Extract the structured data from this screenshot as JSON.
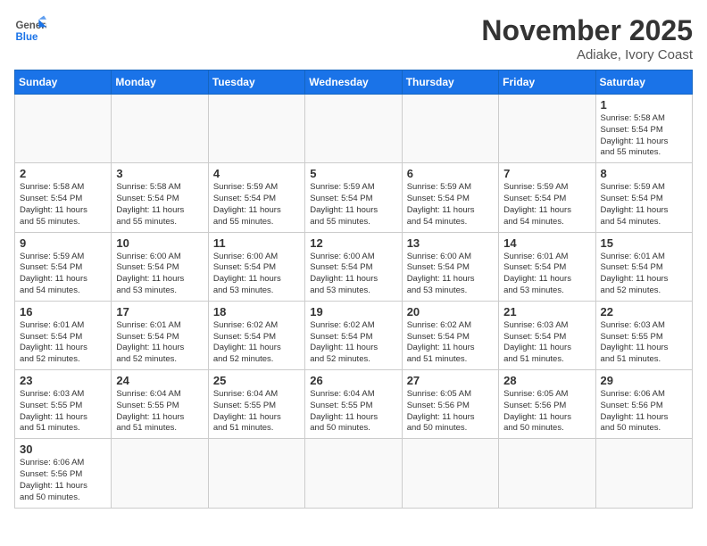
{
  "header": {
    "logo_general": "General",
    "logo_blue": "Blue",
    "month_title": "November 2025",
    "location": "Adiake, Ivory Coast"
  },
  "weekdays": [
    "Sunday",
    "Monday",
    "Tuesday",
    "Wednesday",
    "Thursday",
    "Friday",
    "Saturday"
  ],
  "weeks": [
    [
      {
        "day": "",
        "info": ""
      },
      {
        "day": "",
        "info": ""
      },
      {
        "day": "",
        "info": ""
      },
      {
        "day": "",
        "info": ""
      },
      {
        "day": "",
        "info": ""
      },
      {
        "day": "",
        "info": ""
      },
      {
        "day": "1",
        "info": "Sunrise: 5:58 AM\nSunset: 5:54 PM\nDaylight: 11 hours\nand 55 minutes."
      }
    ],
    [
      {
        "day": "2",
        "info": "Sunrise: 5:58 AM\nSunset: 5:54 PM\nDaylight: 11 hours\nand 55 minutes."
      },
      {
        "day": "3",
        "info": "Sunrise: 5:58 AM\nSunset: 5:54 PM\nDaylight: 11 hours\nand 55 minutes."
      },
      {
        "day": "4",
        "info": "Sunrise: 5:59 AM\nSunset: 5:54 PM\nDaylight: 11 hours\nand 55 minutes."
      },
      {
        "day": "5",
        "info": "Sunrise: 5:59 AM\nSunset: 5:54 PM\nDaylight: 11 hours\nand 55 minutes."
      },
      {
        "day": "6",
        "info": "Sunrise: 5:59 AM\nSunset: 5:54 PM\nDaylight: 11 hours\nand 54 minutes."
      },
      {
        "day": "7",
        "info": "Sunrise: 5:59 AM\nSunset: 5:54 PM\nDaylight: 11 hours\nand 54 minutes."
      },
      {
        "day": "8",
        "info": "Sunrise: 5:59 AM\nSunset: 5:54 PM\nDaylight: 11 hours\nand 54 minutes."
      }
    ],
    [
      {
        "day": "9",
        "info": "Sunrise: 5:59 AM\nSunset: 5:54 PM\nDaylight: 11 hours\nand 54 minutes."
      },
      {
        "day": "10",
        "info": "Sunrise: 6:00 AM\nSunset: 5:54 PM\nDaylight: 11 hours\nand 53 minutes."
      },
      {
        "day": "11",
        "info": "Sunrise: 6:00 AM\nSunset: 5:54 PM\nDaylight: 11 hours\nand 53 minutes."
      },
      {
        "day": "12",
        "info": "Sunrise: 6:00 AM\nSunset: 5:54 PM\nDaylight: 11 hours\nand 53 minutes."
      },
      {
        "day": "13",
        "info": "Sunrise: 6:00 AM\nSunset: 5:54 PM\nDaylight: 11 hours\nand 53 minutes."
      },
      {
        "day": "14",
        "info": "Sunrise: 6:01 AM\nSunset: 5:54 PM\nDaylight: 11 hours\nand 53 minutes."
      },
      {
        "day": "15",
        "info": "Sunrise: 6:01 AM\nSunset: 5:54 PM\nDaylight: 11 hours\nand 52 minutes."
      }
    ],
    [
      {
        "day": "16",
        "info": "Sunrise: 6:01 AM\nSunset: 5:54 PM\nDaylight: 11 hours\nand 52 minutes."
      },
      {
        "day": "17",
        "info": "Sunrise: 6:01 AM\nSunset: 5:54 PM\nDaylight: 11 hours\nand 52 minutes."
      },
      {
        "day": "18",
        "info": "Sunrise: 6:02 AM\nSunset: 5:54 PM\nDaylight: 11 hours\nand 52 minutes."
      },
      {
        "day": "19",
        "info": "Sunrise: 6:02 AM\nSunset: 5:54 PM\nDaylight: 11 hours\nand 52 minutes."
      },
      {
        "day": "20",
        "info": "Sunrise: 6:02 AM\nSunset: 5:54 PM\nDaylight: 11 hours\nand 51 minutes."
      },
      {
        "day": "21",
        "info": "Sunrise: 6:03 AM\nSunset: 5:54 PM\nDaylight: 11 hours\nand 51 minutes."
      },
      {
        "day": "22",
        "info": "Sunrise: 6:03 AM\nSunset: 5:55 PM\nDaylight: 11 hours\nand 51 minutes."
      }
    ],
    [
      {
        "day": "23",
        "info": "Sunrise: 6:03 AM\nSunset: 5:55 PM\nDaylight: 11 hours\nand 51 minutes."
      },
      {
        "day": "24",
        "info": "Sunrise: 6:04 AM\nSunset: 5:55 PM\nDaylight: 11 hours\nand 51 minutes."
      },
      {
        "day": "25",
        "info": "Sunrise: 6:04 AM\nSunset: 5:55 PM\nDaylight: 11 hours\nand 51 minutes."
      },
      {
        "day": "26",
        "info": "Sunrise: 6:04 AM\nSunset: 5:55 PM\nDaylight: 11 hours\nand 50 minutes."
      },
      {
        "day": "27",
        "info": "Sunrise: 6:05 AM\nSunset: 5:56 PM\nDaylight: 11 hours\nand 50 minutes."
      },
      {
        "day": "28",
        "info": "Sunrise: 6:05 AM\nSunset: 5:56 PM\nDaylight: 11 hours\nand 50 minutes."
      },
      {
        "day": "29",
        "info": "Sunrise: 6:06 AM\nSunset: 5:56 PM\nDaylight: 11 hours\nand 50 minutes."
      }
    ],
    [
      {
        "day": "30",
        "info": "Sunrise: 6:06 AM\nSunset: 5:56 PM\nDaylight: 11 hours\nand 50 minutes."
      },
      {
        "day": "",
        "info": ""
      },
      {
        "day": "",
        "info": ""
      },
      {
        "day": "",
        "info": ""
      },
      {
        "day": "",
        "info": ""
      },
      {
        "day": "",
        "info": ""
      },
      {
        "day": "",
        "info": ""
      }
    ]
  ]
}
